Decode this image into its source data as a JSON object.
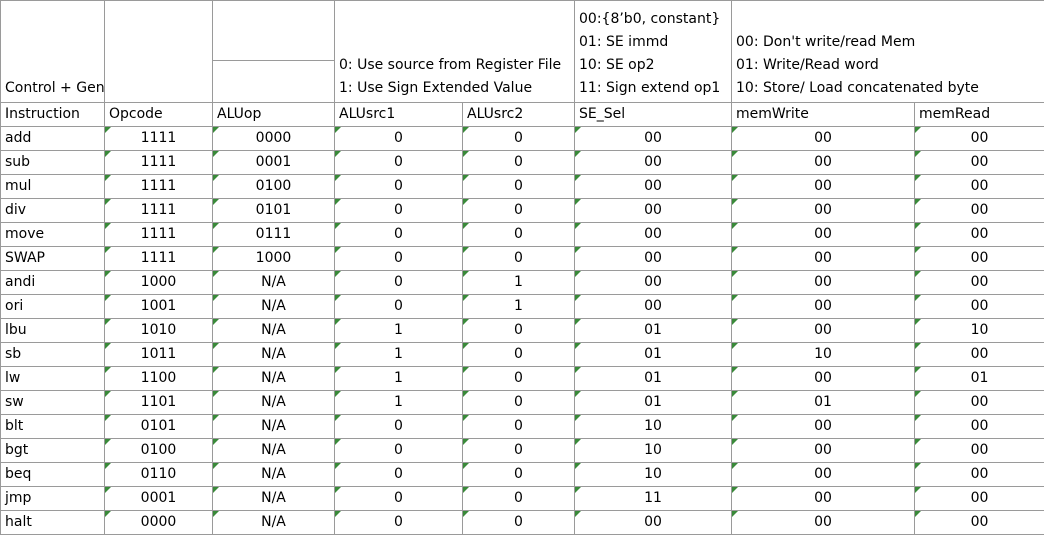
{
  "header": {
    "title": "Control + General TT",
    "alusrc_legend": [
      "0: Use source from Register File",
      "1: Use Sign Extended Value"
    ],
    "se_sel_legend": [
      "00:{8’b0, constant}",
      "01: SE immd",
      "10: SE op2",
      "11: Sign extend op1"
    ],
    "mem_legend": [
      "00: Don't write/read Mem",
      "01: Write/Read word",
      "10: Store/ Load concatenated byte"
    ]
  },
  "columns": [
    "Instruction",
    "Opcode",
    "ALUop",
    "ALUsrc1",
    "ALUsrc2",
    "SE_Sel",
    "memWrite",
    "memRead"
  ],
  "rows": [
    [
      "add",
      "1111",
      "0000",
      "0",
      "0",
      "00",
      "00",
      "00"
    ],
    [
      "sub",
      "1111",
      "0001",
      "0",
      "0",
      "00",
      "00",
      "00"
    ],
    [
      "mul",
      "1111",
      "0100",
      "0",
      "0",
      "00",
      "00",
      "00"
    ],
    [
      "div",
      "1111",
      "0101",
      "0",
      "0",
      "00",
      "00",
      "00"
    ],
    [
      "move",
      "1111",
      "0111",
      "0",
      "0",
      "00",
      "00",
      "00"
    ],
    [
      "SWAP",
      "1111",
      "1000",
      "0",
      "0",
      "00",
      "00",
      "00"
    ],
    [
      "andi",
      "1000",
      "N/A",
      "0",
      "1",
      "00",
      "00",
      "00"
    ],
    [
      "ori",
      "1001",
      "N/A",
      "0",
      "1",
      "00",
      "00",
      "00"
    ],
    [
      "lbu",
      "1010",
      "N/A",
      "1",
      "0",
      "01",
      "00",
      "10"
    ],
    [
      "sb",
      "1011",
      "N/A",
      "1",
      "0",
      "01",
      "10",
      "00"
    ],
    [
      "lw",
      "1100",
      "N/A",
      "1",
      "0",
      "01",
      "00",
      "01"
    ],
    [
      "sw",
      "1101",
      "N/A",
      "1",
      "0",
      "01",
      "01",
      "00"
    ],
    [
      "blt",
      "0101",
      "N/A",
      "0",
      "0",
      "10",
      "00",
      "00"
    ],
    [
      "bgt",
      "0100",
      "N/A",
      "0",
      "0",
      "10",
      "00",
      "00"
    ],
    [
      "beq",
      "0110",
      "N/A",
      "0",
      "0",
      "10",
      "00",
      "00"
    ],
    [
      "jmp",
      "0001",
      "N/A",
      "0",
      "0",
      "11",
      "00",
      "00"
    ],
    [
      "halt",
      "0000",
      "N/A",
      "0",
      "0",
      "00",
      "00",
      "00"
    ]
  ],
  "colors": {
    "gridline": "#9a9a9a",
    "error_indicator": "#3a8a3a"
  }
}
